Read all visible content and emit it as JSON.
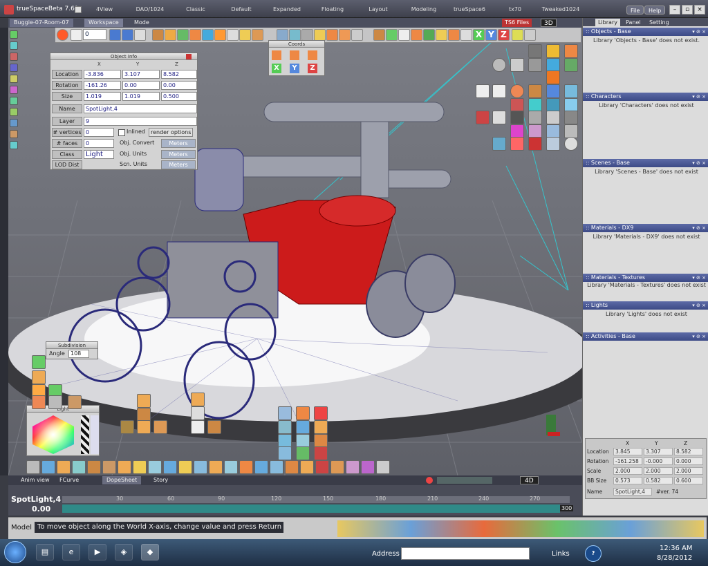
{
  "app": {
    "title": "trueSpaceBeta 7.61"
  },
  "top_tabs": [
    "4View",
    "DAO/1024",
    "Classic",
    "Default",
    "Expanded",
    "Floating",
    "Layout",
    "Modeling",
    "trueSpace6",
    "tx70",
    "Tweaked1024"
  ],
  "top_buttons": {
    "file": "File",
    "help": "Help"
  },
  "sub_tabs": {
    "scene": "Buggie-07-Room-07",
    "workspace": "Workspace",
    "mode": "Mode"
  },
  "frame_counter": "0",
  "ts6_files": "TS6 Files",
  "view_3d": "3D",
  "right_tabs": [
    "Library",
    "Panel",
    "Setting"
  ],
  "coords_title": "Coords",
  "axes": {
    "x": "X",
    "y": "Y",
    "z": "Z"
  },
  "object_info": {
    "title": "Object Info",
    "cols": [
      "X",
      "Y",
      "Z"
    ],
    "rows": [
      {
        "label": "Location",
        "values": [
          "-3.836",
          "3.107",
          "8.582"
        ]
      },
      {
        "label": "Rotation",
        "values": [
          "-161.26",
          "0.00",
          "0.00"
        ]
      },
      {
        "label": "Size",
        "values": [
          "1.019",
          "1.019",
          "0.500"
        ]
      }
    ],
    "name_label": "Name",
    "name_value": "SpotLight,4",
    "layer_label": "Layer",
    "layer_value": "9",
    "vertices_label": "# vertices",
    "vertices_value": "0",
    "faces_label": "# faces",
    "faces_value": "0",
    "class_label": "Class",
    "class_value": "Light",
    "lod_label": "LOD Dist",
    "inlined_label": "Inlined",
    "render_options": "render options",
    "obj_convert": "Obj. Convert",
    "obj_units": "Obj. Units",
    "scn_units": "Scn. Units",
    "meters": "Meters"
  },
  "library_sections": [
    {
      "title": ":: Objects - Base",
      "msg": "Library 'Objects - Base' does not exist."
    },
    {
      "title": ":: Characters",
      "msg": "Library 'Characters' does not exist"
    },
    {
      "title": ":: Scenes - Base",
      "msg": "Library 'Scenes - Base' does not exist"
    },
    {
      "title": ":: Materials - DX9",
      "msg": "Library 'Materials - DX9' does not exist"
    },
    {
      "title": ":: Materials - Textures",
      "msg": "Library 'Materials - Textures' does not exist"
    },
    {
      "title": ":: Lights",
      "msg": "Library 'Lights' does not exist"
    },
    {
      "title": ":: Activities - Base",
      "msg": ""
    }
  ],
  "object_table": {
    "cols": [
      "X",
      "Y",
      "Z"
    ],
    "rows": [
      {
        "label": "Location",
        "values": [
          "3.845",
          "3.307",
          "8.582"
        ]
      },
      {
        "label": "Rotation",
        "values": [
          "-161.258",
          "-0.000",
          "0.000"
        ]
      },
      {
        "label": "Scale",
        "values": [
          "2.000",
          "2.000",
          "2.000"
        ]
      },
      {
        "label": "BB Size",
        "values": [
          "0.573",
          "0.582",
          "0.600"
        ]
      }
    ],
    "name_label": "Name",
    "name_value": "SpotLight,4",
    "ver": "#ver. 74"
  },
  "subdivision": {
    "title": "Subdivision",
    "angle_label": "Angle",
    "angle_value": "108"
  },
  "light_panel_title": "Light",
  "bottom_tabs": [
    "Anim view",
    "FCurve",
    "DopeSheet",
    "Story"
  ],
  "view_4d": "4D",
  "timeline": {
    "object": "SpotLight,4",
    "time": "0.00",
    "ticks": [
      "30",
      "60",
      "90",
      "120",
      "150",
      "180",
      "210",
      "240",
      "270"
    ],
    "end": "300"
  },
  "status": {
    "label": "Model",
    "text": "To move object along the World X-axis, change value and press Return"
  },
  "taskbar": {
    "address_label": "Address",
    "links": "Links",
    "time": "12:36 AM",
    "date": "8/28/2012"
  },
  "colors": {
    "accent": "#4a5a9e",
    "red_body": "#cc1b1b",
    "wire": "#2a2a7a"
  }
}
